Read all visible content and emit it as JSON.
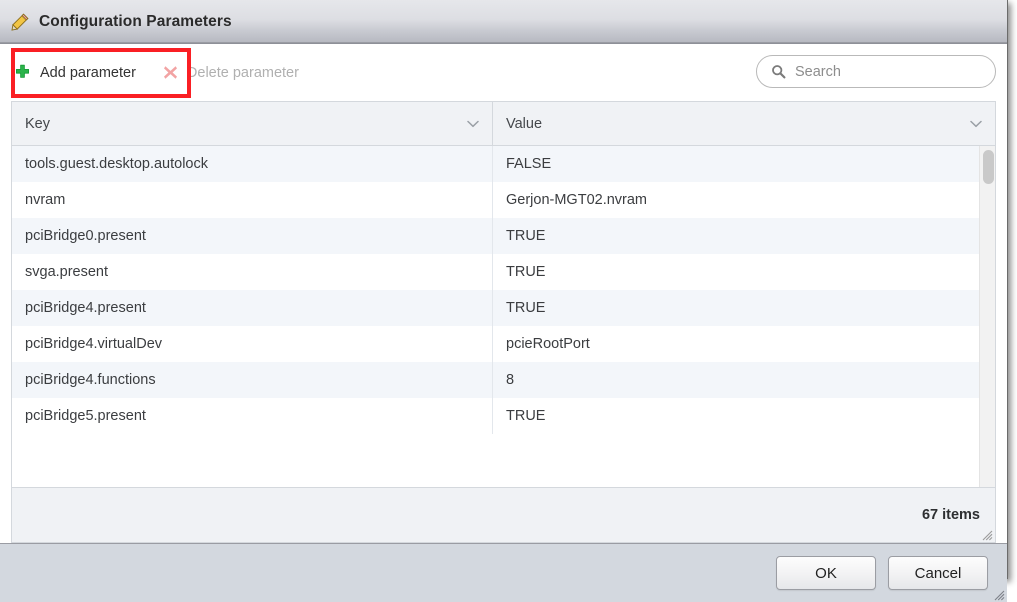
{
  "window": {
    "title": "Configuration Parameters",
    "title_icon": "pencil-icon"
  },
  "toolbar": {
    "add_label": "Add parameter",
    "add_icon": "plus-icon",
    "delete_label": "Delete parameter",
    "delete_icon": "x-icon",
    "delete_disabled": true
  },
  "search": {
    "placeholder": "Search",
    "value": "",
    "icon": "search-icon"
  },
  "grid": {
    "columns": [
      {
        "label": "Key",
        "sort_icon": "chevron-down-icon"
      },
      {
        "label": "Value",
        "sort_icon": "chevron-down-icon"
      }
    ],
    "rows": [
      {
        "key": "tools.guest.desktop.autolock",
        "value": "FALSE"
      },
      {
        "key": "nvram",
        "value": "Gerjon-MGT02.nvram"
      },
      {
        "key": "pciBridge0.present",
        "value": "TRUE"
      },
      {
        "key": "svga.present",
        "value": "TRUE"
      },
      {
        "key": "pciBridge4.present",
        "value": "TRUE"
      },
      {
        "key": "pciBridge4.virtualDev",
        "value": "pcieRootPort"
      },
      {
        "key": "pciBridge4.functions",
        "value": "8"
      },
      {
        "key": "pciBridge5.present",
        "value": "TRUE"
      }
    ],
    "item_count": "67 items"
  },
  "footer": {
    "ok_label": "OK",
    "cancel_label": "Cancel"
  },
  "annotation": {
    "color": "#fa1f24",
    "target": "add-parameter-button"
  },
  "colors": {
    "annotation_red": "#fa1f24",
    "add_icon_green": "#27b14a",
    "delete_icon_red": "#f1a0a0",
    "titlebar_top": "#e6e7eb",
    "titlebar_bottom": "#b6b8c0",
    "row_alt": "#f3f6fa",
    "footer_bar": "#d3d8df"
  }
}
